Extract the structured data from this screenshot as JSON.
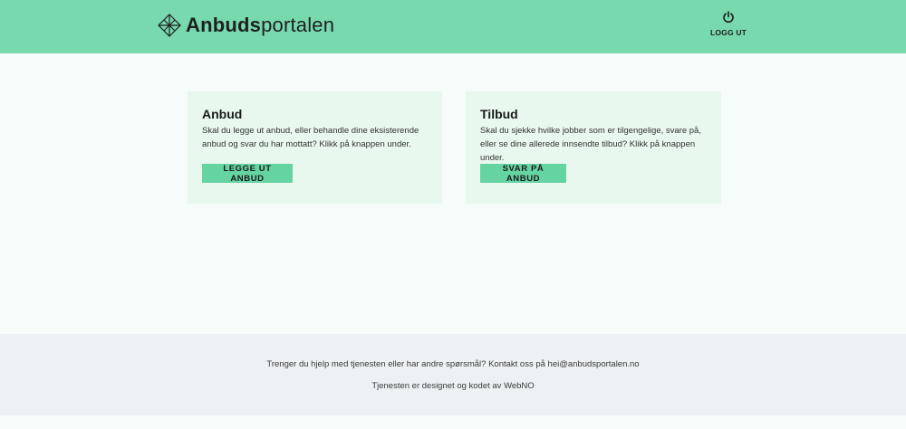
{
  "header": {
    "logo_text_bold": "Anbuds",
    "logo_text_regular": "portalen",
    "logo_icon": "diamond-compass-icon",
    "logout_label": "LOGG UT",
    "logout_icon": "power-icon"
  },
  "cards": [
    {
      "title": "Anbud",
      "text": "Skal du legge ut anbud, eller behandle dine eksisterende anbud og svar du har mottatt? Klikk på knappen under.",
      "button": "LEGGE UT ANBUD"
    },
    {
      "title": "Tilbud",
      "text": "Skal du sjekke hvilke jobber som er tilgengelige, svare på, eller se dine allerede innsendte tilbud? Klikk på knappen under.",
      "button": "SVAR PÅ ANBUD"
    }
  ],
  "footer": {
    "help_text": "Trenger du hjelp med tjenesten eller har andre spørsmål? Kontakt oss på hei@anbudsportalen.no",
    "credit_text": "Tjenesten er designet og kodet av WebNO"
  },
  "colors": {
    "header_bg": "#77d9ad",
    "button_bg": "#66d3a2",
    "card_bg": "#e8f8ef",
    "page_bg": "#f5fcf9",
    "footer_bg": "#edf1f3"
  }
}
